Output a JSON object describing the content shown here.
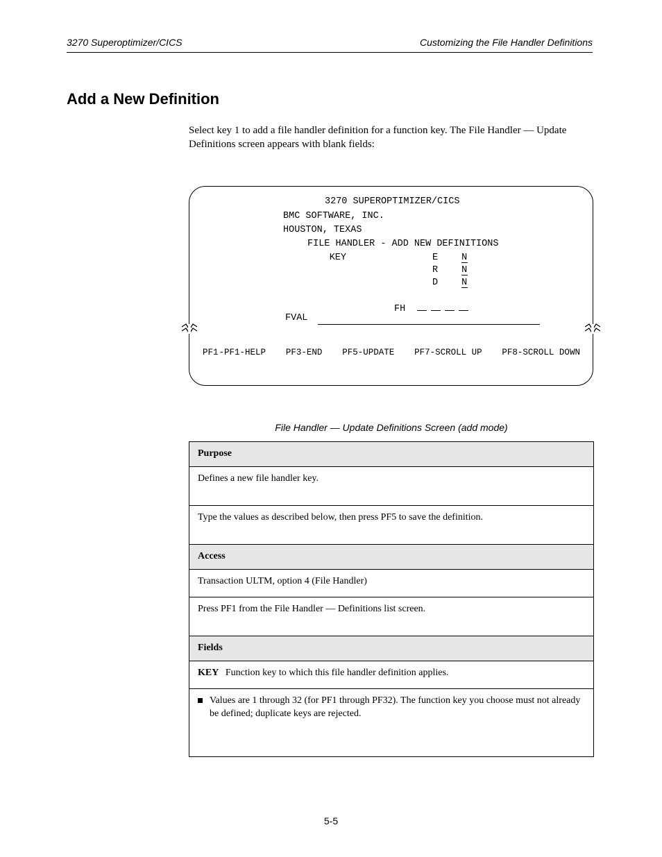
{
  "header": {
    "left": "3270 Superoptimizer/CICS",
    "right": "Customizing the File Handler Definitions"
  },
  "section_heading": "Add a New Definition",
  "intro": "Select key 1 to add a file handler definition for a function key. The File Handler — Update Definitions screen appears with blank fields:",
  "screen": {
    "title": "3270 SUPEROPTIMIZER/CICS",
    "addr1": "BMC SOFTWARE, INC.",
    "addr2": "HOUSTON, TEXAS",
    "subtitle": "FILE HANDLER - ADD NEW DEFINITIONS",
    "center_label": "KEY",
    "flags": [
      {
        "label": "E",
        "value": "N"
      },
      {
        "label": "R",
        "value": "N"
      },
      {
        "label": "D",
        "value": "N"
      }
    ],
    "fh_label": "FH",
    "fh_slots": 4,
    "fval_label": "FVAL",
    "fkeys": [
      "PF1-HELP",
      "PF3-END",
      "PF5-UPDATE",
      "PF7-SCROLL UP",
      "PF8-SCROLL DOWN"
    ]
  },
  "table_caption": "File Handler — Update Definitions Screen (add mode)",
  "rows": {
    "g1_title": "Purpose",
    "g1_r1": "Defines a new file handler key.",
    "g1_r2": "Type the values as described below, then press PF5 to save the definition.",
    "g2_title": "Access",
    "g2_r1": "Transaction ULTM, option 4 (File Handler)",
    "g2_r2": "Press PF1 from the File Handler — Definitions list screen.",
    "g3_title": "Fields",
    "g3_r1_label": "KEY",
    "g3_r1_text": "Function key to which this file handler definition applies.",
    "g3_r2_bullet": "Values are 1 through 32 (for PF1 through PF32). The function key you choose must not already be defined; duplicate keys are rejected."
  },
  "page_number": "5-5"
}
